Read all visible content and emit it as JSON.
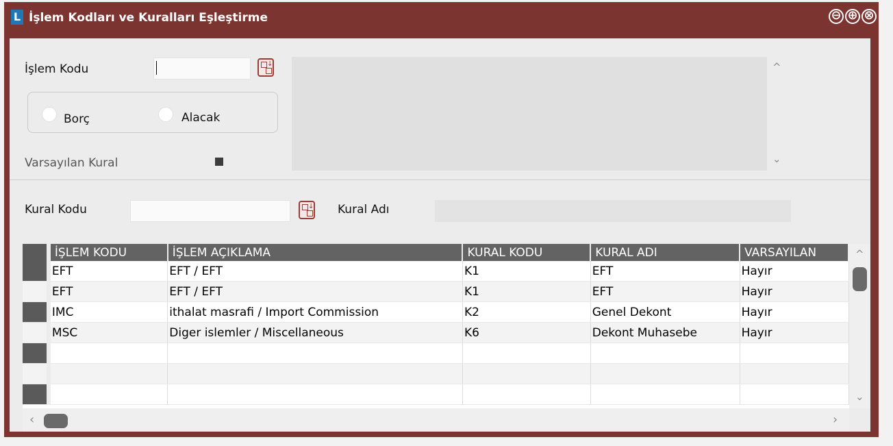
{
  "window": {
    "app_logo": "L",
    "title": "İşlem Kodları ve Kuralları Eşleştirme",
    "controls": {
      "minimize": "⊖",
      "maximize": "⊕",
      "close": "⊗"
    }
  },
  "form": {
    "islem_kodu_label": "İşlem Kodu",
    "islem_kodu_value": "",
    "borc_label": "Borç",
    "alacak_label": "Alacak",
    "varsayilan_label": "Varsayılan Kural",
    "kural_kodu_label": "Kural Kodu",
    "kural_kodu_value": "",
    "kural_adi_label": "Kural Adı",
    "kural_adi_value": ""
  },
  "scroll_glyphs": {
    "up": "^",
    "down": "⌄",
    "left": "‹",
    "right": "›"
  },
  "grid": {
    "headers": [
      "İŞLEM KODU",
      "İŞLEM AÇIKLAMA",
      "KURAL KODU",
      "KURAL ADI",
      "VARSAYILAN"
    ],
    "rows": [
      [
        "EFT",
        "EFT / EFT",
        "K1",
        "EFT",
        "Hayır"
      ],
      [
        "EFT",
        "EFT / EFT",
        "K1",
        "EFT",
        "Hayır"
      ],
      [
        "IMC",
        "ithalat masrafi / Import Commission",
        "K2",
        "Genel Dekont",
        "Hayır"
      ],
      [
        "MSC",
        "Diger islemler / Miscellaneous",
        "K6",
        "Dekont Muhasebe",
        "Hayır"
      ],
      [
        "",
        "",
        "",
        "",
        ""
      ],
      [
        "",
        "",
        "",
        "",
        ""
      ],
      [
        "",
        "",
        "",
        "",
        ""
      ]
    ]
  }
}
